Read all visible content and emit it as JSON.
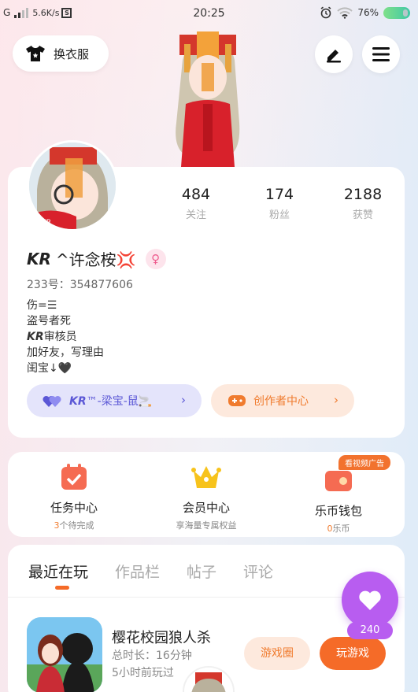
{
  "status_bar": {
    "network": "G",
    "speed": "5.6K/s",
    "time": "20:25",
    "battery": "76%"
  },
  "header": {
    "outfit_label": "换衣服",
    "edit_icon": "pencil-icon",
    "menu_icon": "menu-icon"
  },
  "profile": {
    "stats": [
      {
        "value": "484",
        "label": "关注"
      },
      {
        "value": "174",
        "label": "粉丝"
      },
      {
        "value": "2188",
        "label": "获赞"
      }
    ],
    "name_prefix": "KR",
    "name_rest": "^许念桉💢",
    "gender_symbol": "♀",
    "uid": "233号：354877606",
    "bio": {
      "line1": "伤=☰",
      "line2": "盗号者死",
      "line3_prefix": "KR",
      "line3_rest": "审核员",
      "line4": "加好友，写理由",
      "line5": "闺宝↓🖤"
    },
    "team_pill": {
      "prefix": "KR",
      "rest": "™-梁宝-鼠🚬"
    },
    "creator_pill": "创作者中心"
  },
  "services": [
    {
      "title": "任务中心",
      "count": "3",
      "sub": "个待完成",
      "icon": "task-calendar-icon"
    },
    {
      "title": "会员中心",
      "count": "",
      "sub": "享海量专属权益",
      "icon": "crown-icon"
    },
    {
      "title": "乐币钱包",
      "count": "0",
      "sub": "乐币",
      "icon": "wallet-icon",
      "badge": "看视频广告"
    }
  ],
  "tabs": [
    "最近在玩",
    "作品栏",
    "帖子",
    "评论"
  ],
  "active_tab": 0,
  "recent_game": {
    "title": "樱花校园狼人杀",
    "duration": "总时长：16分钟",
    "last_played": "5小时前玩过",
    "circle_label": "游戏圈",
    "play_label": "玩游戏"
  },
  "like_fab": {
    "count": "240"
  },
  "colors": {
    "accent": "#f56b28",
    "purple": "#b85df0",
    "indigo": "#5b57d6"
  }
}
